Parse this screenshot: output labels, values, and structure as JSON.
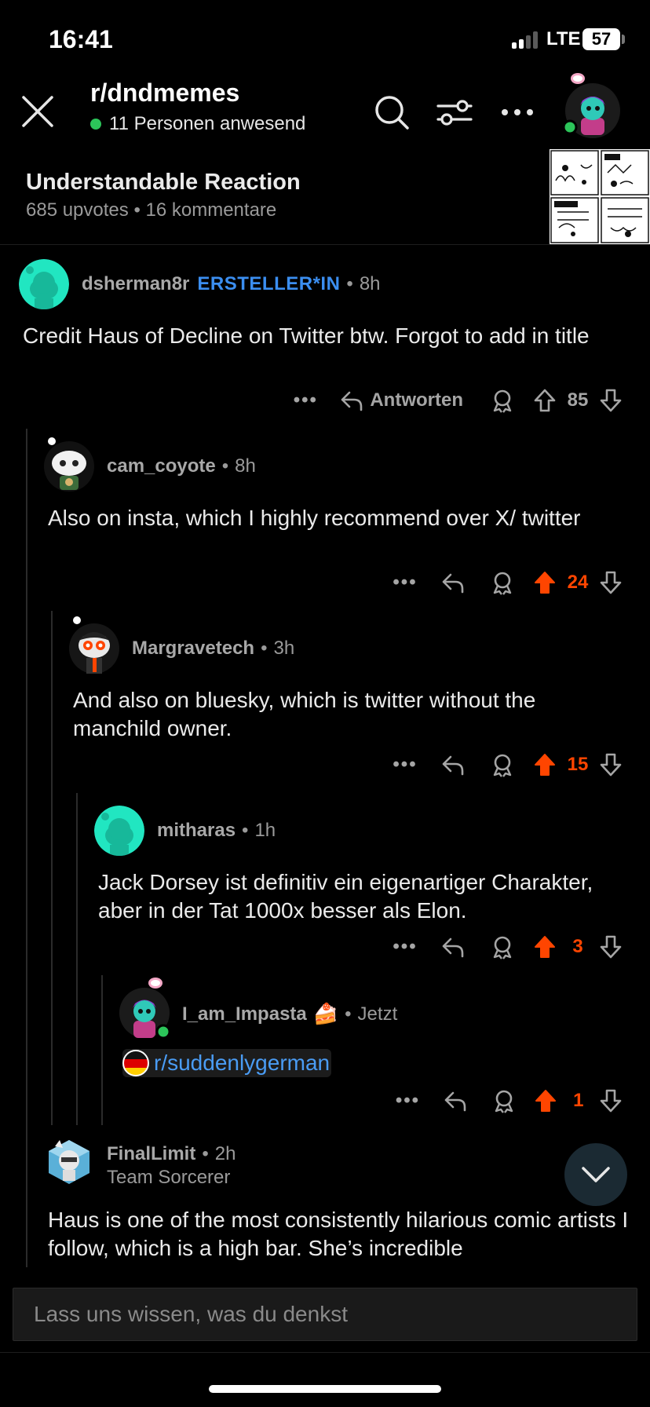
{
  "status_bar": {
    "time": "16:41",
    "network": "LTE",
    "battery": "57"
  },
  "header": {
    "subreddit": "r/dndmemes",
    "online_text": "11 Personen anwesend",
    "icons": [
      "close-icon",
      "search-icon",
      "filter-icon",
      "more-icon",
      "user-avatar"
    ]
  },
  "post": {
    "title": "Understandable Reaction",
    "meta": "685 upvotes • 16 kommentare"
  },
  "comments": [
    {
      "author": "dsherman8r",
      "op_badge": "ERSTELLER*IN",
      "time": "8h",
      "body": "Credit Haus of Decline on Twitter btw. Forgot to add in title",
      "reply_label": "Antworten",
      "score": "85",
      "upvoted": false
    },
    {
      "author": "cam_coyote",
      "time": "8h",
      "body": "Also on insta, which I highly recommend over X/ twitter",
      "score": "24",
      "upvoted": true
    },
    {
      "author": "Margravetech",
      "time": "3h",
      "body": "And also on bluesky, which is twitter without the manchild owner.",
      "score": "15",
      "upvoted": true
    },
    {
      "author": "mitharas",
      "time": "1h",
      "body": "Jack Dorsey ist definitiv ein eigenartiger Charakter, aber in der Tat 1000x besser als Elon.",
      "score": "3",
      "upvoted": true
    },
    {
      "author": "I_am_Impasta",
      "author_emoji": "🍰",
      "time": "Jetzt",
      "body_link": "r/suddenlygerman",
      "score": "1",
      "upvoted": true
    },
    {
      "author": "FinalLimit",
      "time": "2h",
      "flair": "Team Sorcerer",
      "body": "Haus is one of the most consistently hilarious comic artists I follow, which is a high bar. She’s incredible"
    }
  ],
  "separator": "•",
  "more_label": "•••",
  "composer": {
    "placeholder": "Lass uns wissen, was du denkst"
  },
  "colors": {
    "upvote": "#ff4500",
    "op_badge": "#3b8ef0",
    "online": "#2cc55a",
    "link": "#4a9cf4"
  }
}
